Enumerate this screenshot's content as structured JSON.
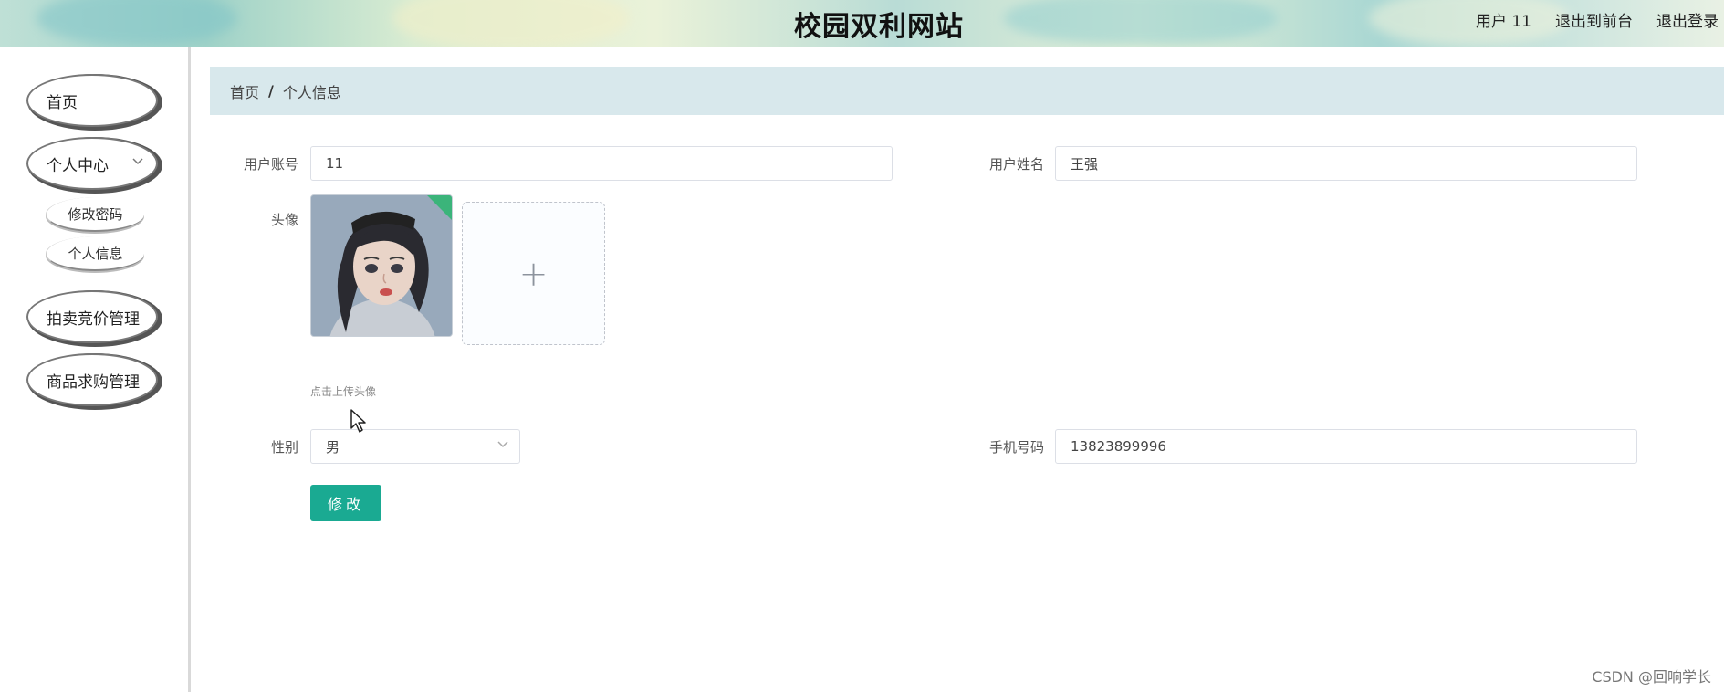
{
  "header": {
    "title": "校园双利网站",
    "user_label": "用户 11",
    "back_front_label": "退出到前台",
    "logout_label": "退出登录"
  },
  "sidebar": {
    "items": [
      {
        "label": "首页"
      },
      {
        "label": "个人中心",
        "expanded": true,
        "children": [
          {
            "label": "修改密码"
          },
          {
            "label": "个人信息"
          }
        ]
      },
      {
        "label": "拍卖竞价管理"
      },
      {
        "label": "商品求购管理"
      }
    ]
  },
  "breadcrumb": {
    "home": "首页",
    "separator": "/",
    "current": "个人信息"
  },
  "form": {
    "account": {
      "label": "用户账号",
      "value": "11"
    },
    "name": {
      "label": "用户姓名",
      "value": "王强"
    },
    "avatar": {
      "label": "头像",
      "hint": "点击上传头像",
      "add_symbol": "+"
    },
    "gender": {
      "label": "性别",
      "value": "男"
    },
    "phone": {
      "label": "手机号码",
      "value": "13823899996"
    },
    "submit_label": "修改"
  },
  "watermark": "CSDN @回响学长",
  "colors": {
    "primary": "#1aaa92",
    "breadcrumb_bg": "#d8e8ec",
    "success_check": "#3bb47a"
  },
  "icons": {
    "chevron": "chevron-down-icon",
    "upload": "plus-icon",
    "cursor": "mouse-pointer-icon"
  }
}
